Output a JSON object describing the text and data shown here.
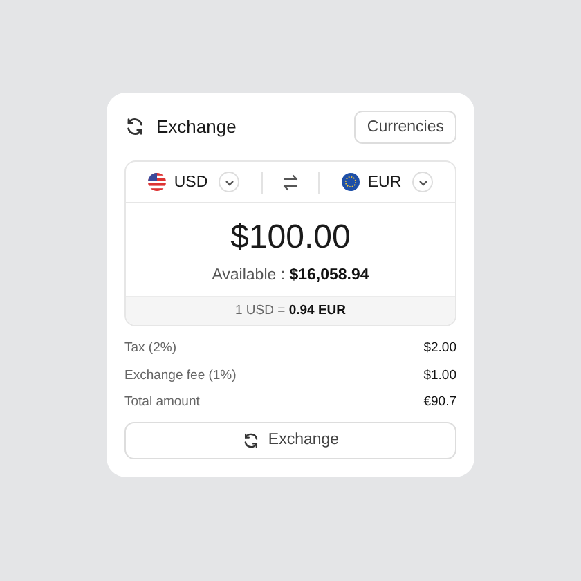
{
  "header": {
    "title": "Exchange",
    "button": "Currencies"
  },
  "from": {
    "code": "USD"
  },
  "to": {
    "code": "EUR"
  },
  "amount": "$100.00",
  "available": "Available : **$16,058.94**",
  "rate": "1 USD = **0.94 EUR**",
  "summary": [
    {
      "label": "Tax (2%)",
      "value": "$2.00"
    },
    {
      "label": "Exchange fee (1%)",
      "value": "$1.00"
    },
    {
      "label": "Total amount",
      "value": "€90.7"
    }
  ],
  "action": "Exchange"
}
